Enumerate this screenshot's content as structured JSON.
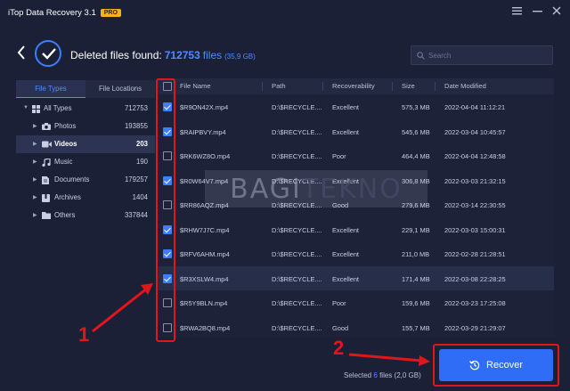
{
  "app": {
    "title": "iTop Data Recovery 3.1",
    "badge": "PRO",
    "accent_color": "#3d7eff",
    "annotation_color": "#e0161b"
  },
  "window_controls": [
    "menu-icon",
    "minimize-icon",
    "close-icon"
  ],
  "header": {
    "prefix": "Deleted files found:",
    "count": "712753",
    "unit": "files",
    "size": "(35,9 GB)"
  },
  "search": {
    "placeholder": "Search"
  },
  "sidebar": {
    "tabs": [
      {
        "label": "File Types",
        "active": true
      },
      {
        "label": "File Locations",
        "active": false
      }
    ],
    "items": [
      {
        "label": "All Types",
        "count": "712753",
        "icon": "grid-icon"
      },
      {
        "label": "Photos",
        "count": "193855",
        "icon": "camera-icon"
      },
      {
        "label": "Videos",
        "count": "203",
        "icon": "video-icon",
        "selected": true
      },
      {
        "label": "Music",
        "count": "190",
        "icon": "music-icon"
      },
      {
        "label": "Documents",
        "count": "179257",
        "icon": "document-icon"
      },
      {
        "label": "Archives",
        "count": "1404",
        "icon": "archive-icon"
      },
      {
        "label": "Others",
        "count": "337844",
        "icon": "folder-icon"
      }
    ]
  },
  "table": {
    "columns": [
      "File Name",
      "Path",
      "Recoverability",
      "Size",
      "Date Modified"
    ],
    "rows": [
      {
        "name": "$R9ON42X.mp4",
        "path": "D:\\$RECYCLE....",
        "recoverability": "Excellent",
        "size": "575,3 MB",
        "date": "2022-04-04 11:12:21",
        "checked": true
      },
      {
        "name": "$RAIPBVY.mp4",
        "path": "D:\\$RECYCLE....",
        "recoverability": "Excellent",
        "size": "545,6 MB",
        "date": "2022-03-04 10:45:57",
        "checked": true
      },
      {
        "name": "$RK6WZ8O.mp4",
        "path": "D:\\$RECYCLE....",
        "recoverability": "Poor",
        "size": "464,4 MB",
        "date": "2022-04-04 12:48:58",
        "checked": false
      },
      {
        "name": "$R0W64V7.mp4",
        "path": "D:\\$RECYCLE....",
        "recoverability": "Excellent",
        "size": "306,8 MB",
        "date": "2022-03-03 21:32:15",
        "checked": true
      },
      {
        "name": "$RR86AQZ.mp4",
        "path": "D:\\$RECYCLE....",
        "recoverability": "Good",
        "size": "279,6 MB",
        "date": "2022-03-14 22:30:55",
        "checked": false
      },
      {
        "name": "$RHW7J7C.mp4",
        "path": "D:\\$RECYCLE....",
        "recoverability": "Excellent",
        "size": "229,1 MB",
        "date": "2022-03-03 15:00:31",
        "checked": true
      },
      {
        "name": "$RFV6AHM.mp4",
        "path": "D:\\$RECYCLE....",
        "recoverability": "Excellent",
        "size": "211,0 MB",
        "date": "2022-02-28 21:28:51",
        "checked": true
      },
      {
        "name": "$R3XSLW4.mp4",
        "path": "D:\\$RECYCLE....",
        "recoverability": "Excellent",
        "size": "171,4 MB",
        "date": "2022-03-08 22:28:25",
        "checked": true,
        "highlight": true
      },
      {
        "name": "$R5Y9BLN.mp4",
        "path": "D:\\$RECYCLE....",
        "recoverability": "Poor",
        "size": "159,6 MB",
        "date": "2022-03-23 17:25:08",
        "checked": false
      },
      {
        "name": "$RWA2BQ8.mp4",
        "path": "D:\\$RECYCLE....",
        "recoverability": "Good",
        "size": "155,7 MB",
        "date": "2022-03-29 21:29:07",
        "checked": false
      }
    ]
  },
  "watermark": {
    "part1": "BAGI",
    "part2": "TEKNO"
  },
  "annotations": {
    "one": "1",
    "two": "2"
  },
  "footer": {
    "selected_prefix": "Selected",
    "selected_count": "6",
    "selected_unit": "files",
    "selected_size": "(2,0 GB)",
    "recover_label": "Recover"
  }
}
